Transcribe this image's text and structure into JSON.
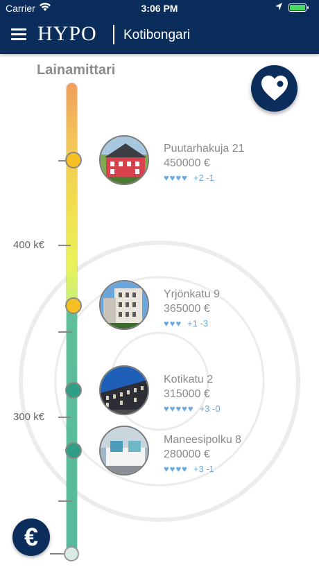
{
  "status_bar": {
    "carrier": "Carrier",
    "time": "3:06 PM"
  },
  "nav": {
    "logo": "HYPO",
    "subtitle": "Kotibongari"
  },
  "meter": {
    "title": "Lainamittari",
    "tick_labels": [
      "400 k€",
      "300 k€"
    ]
  },
  "listings": [
    {
      "name": "Puutarhakuja 21",
      "price": "450000 €",
      "hearts": "♥♥♥♥",
      "votes": "+2 -1"
    },
    {
      "name": "Yrjönkatu 9",
      "price": "365000 €",
      "hearts": "♥♥♥",
      "votes": "+1 -3"
    },
    {
      "name": "Kotikatu 2",
      "price": "315000 €",
      "hearts": "♥♥♥♥♥",
      "votes": "+3 -0"
    },
    {
      "name": "Maneesipolku 8",
      "price": "280000 €",
      "hearts": "♥♥♥♥",
      "votes": "+3 -1"
    }
  ],
  "buttons": {
    "euro": "€"
  },
  "colors": {
    "brand": "#0b2d5c",
    "marker_high": "#f6c024",
    "marker_low": "#2f9e84",
    "heart": "#69a9e0"
  }
}
